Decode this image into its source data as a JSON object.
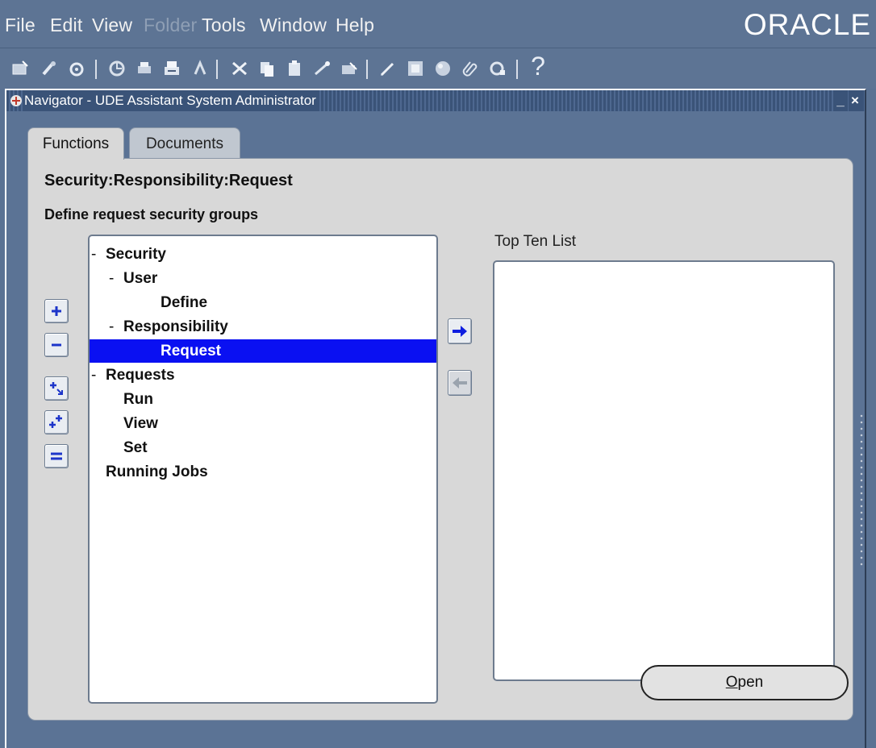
{
  "menubar": {
    "items": [
      "File",
      "Edit",
      "View",
      "Folder",
      "Tools",
      "Window",
      "Help"
    ],
    "brand": "ORACLE"
  },
  "toolbar": {
    "icons": [
      "new-icon",
      "find-icon",
      "navigator-icon",
      "save-icon",
      "print-icon",
      "print-setup-icon",
      "close-form-icon",
      "cut-icon",
      "copy-icon",
      "paste-icon",
      "clear-icon",
      "delete-icon",
      "edit-field-icon",
      "zoom-icon",
      "translations-icon",
      "attachments-icon",
      "folder-tools-icon",
      "help-icon"
    ],
    "help_label": "?"
  },
  "window": {
    "title": "Navigator - UDE Assistant System Administrator",
    "minimize_glyph": "_",
    "close_glyph": "×"
  },
  "tabs": [
    {
      "label": "Functions",
      "active": true
    },
    {
      "label": "Documents",
      "active": false
    }
  ],
  "panel": {
    "path": "Security:Responsibility:Request",
    "description": "Define request security groups",
    "top_ten_label": "Top Ten List"
  },
  "tree": [
    {
      "prefix": "-",
      "label": "Security",
      "indent": 0,
      "selected": false
    },
    {
      "prefix": "-",
      "label": "User",
      "indent": 1,
      "selected": false
    },
    {
      "prefix": "",
      "label": "Define",
      "indent": 2,
      "selected": false
    },
    {
      "prefix": "-",
      "label": "Responsibility",
      "indent": 1,
      "selected": false
    },
    {
      "prefix": "",
      "label": "Request",
      "indent": 2,
      "selected": true
    },
    {
      "prefix": "-",
      "label": "Requests",
      "indent": 0,
      "selected": false
    },
    {
      "prefix": "",
      "label": "Run",
      "indent": 1,
      "selected": false
    },
    {
      "prefix": "",
      "label": "View",
      "indent": 1,
      "selected": false
    },
    {
      "prefix": "",
      "label": "Set",
      "indent": 1,
      "selected": false
    },
    {
      "prefix": "",
      "label": "Running Jobs",
      "indent": 0,
      "selected": false
    }
  ],
  "buttons": {
    "open_mnemonic": "O",
    "open_rest": "pen"
  },
  "colors": {
    "background": "#5a7293",
    "selection": "#0a10f2",
    "panel": "#d8d8d8"
  }
}
